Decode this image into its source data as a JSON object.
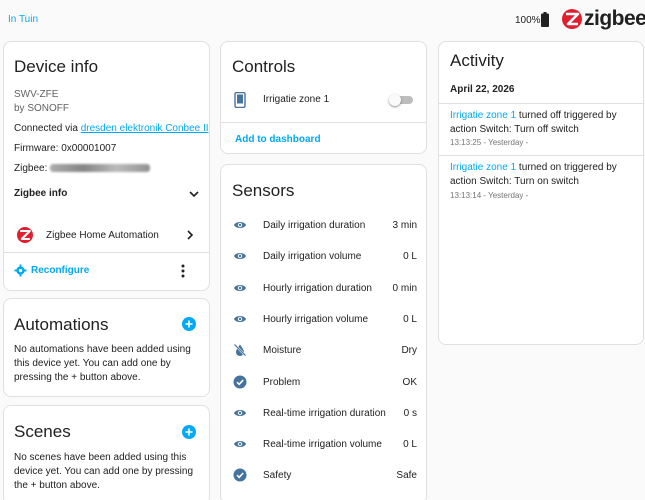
{
  "topbar": {
    "area": "In Tuin",
    "battery": "100%",
    "brand": "zigbee"
  },
  "device_info": {
    "title": "Device info",
    "model": "SWV-ZFE",
    "by": "by SONOFF",
    "connected_prefix": "Connected via ",
    "connected_link": "dresden elektronik Conbee II",
    "firmware": "Firmware: 0x00001007",
    "zigbee_label": "Zigbee: ",
    "zigbee_info": "Zigbee info",
    "integration": "Zigbee Home Automation",
    "reconfigure": "Reconfigure"
  },
  "automations": {
    "title": "Automations",
    "text": "No automations have been added using this device yet. You can add one by pressing the + button above."
  },
  "scenes": {
    "title": "Scenes",
    "text": "No scenes have been added using this device yet. You can add one by pressing the + button above."
  },
  "controls": {
    "title": "Controls",
    "entity": "Irrigatie zone 1",
    "add_to_dashboard": "Add to dashboard"
  },
  "sensors": {
    "title": "Sensors",
    "rows": [
      {
        "label": "Daily irrigation duration",
        "value": "3 min",
        "icon": "eye-icon"
      },
      {
        "label": "Daily irrigation volume",
        "value": "0 L",
        "icon": "eye-icon"
      },
      {
        "label": "Hourly irrigation duration",
        "value": "0 min",
        "icon": "eye-icon"
      },
      {
        "label": "Hourly irrigation volume",
        "value": "0 L",
        "icon": "eye-icon"
      },
      {
        "label": "Moisture",
        "value": "Dry",
        "icon": "water-off-icon"
      },
      {
        "label": "Problem",
        "value": "OK",
        "icon": "check-circle-icon"
      },
      {
        "label": "Real-time irrigation duration",
        "value": "0 s",
        "icon": "eye-icon"
      },
      {
        "label": "Real-time irrigation volume",
        "value": "0 L",
        "icon": "eye-icon"
      },
      {
        "label": "Safety",
        "value": "Safe",
        "icon": "check-circle-icon"
      }
    ]
  },
  "activity": {
    "title": "Activity",
    "date": "April 22, 2026",
    "entries": [
      {
        "entity": "Irrigatie zone 1",
        "text": " turned off triggered by action Switch: Turn off switch",
        "time": "13:13:25 - Yesterday -"
      },
      {
        "entity": "Irrigatie zone 1",
        "text": " turned on triggered by action Switch: Turn on switch",
        "time": "13:13:14 - Yesterday -"
      }
    ]
  },
  "colors": {
    "accent": "#03a9f4",
    "icon": "#44739e",
    "brand_red": "#e01e2e"
  }
}
